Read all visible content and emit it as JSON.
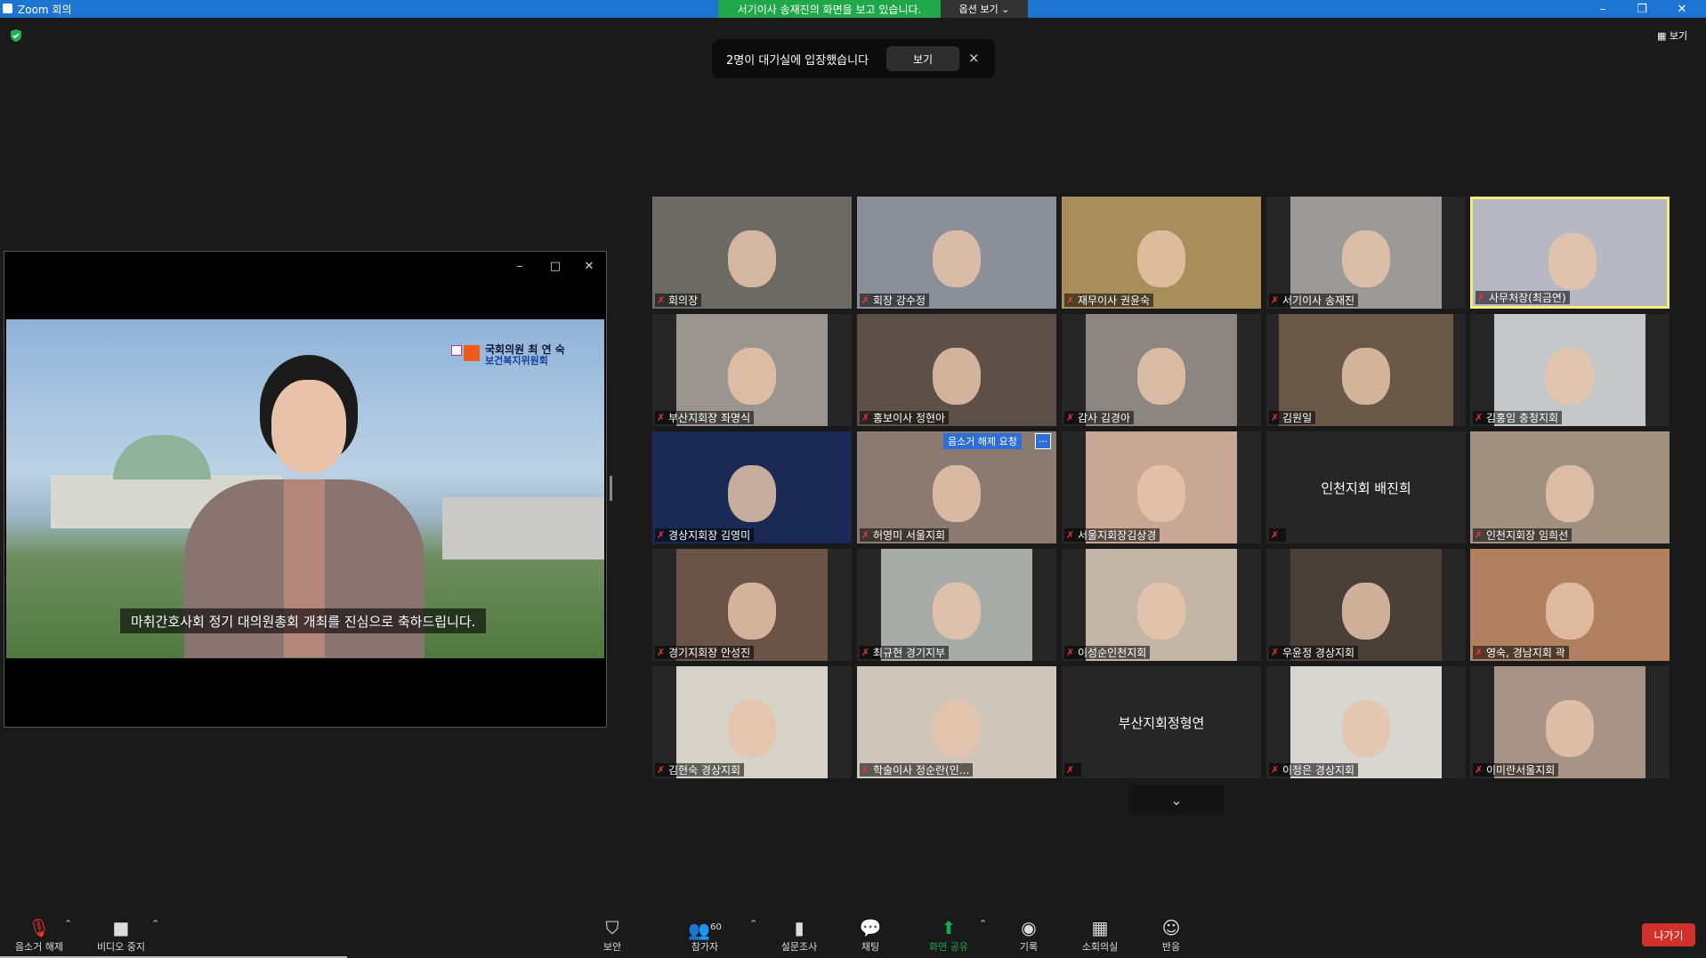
{
  "window": {
    "title": "Zoom 회의",
    "minimize": "–",
    "restore": "❐",
    "close": "✕"
  },
  "share_banner": {
    "text": "서기이사 송재진의 화면을 보고 있습니다.",
    "view_options": "옵션 보기 ⌄"
  },
  "waiting_toast": {
    "message": "2명이 대기실에 입장했습니다",
    "view_button": "보기",
    "close": "×"
  },
  "gallery_view": "▦ 보기",
  "share_window": {
    "minimize": "–",
    "maximize": "□",
    "close": "✕",
    "subtitle": "마취간호사회 정기 대의원총회 개최를 진심으로 축하드립니다.",
    "logo_line1": "국회의원 최 연 숙",
    "logo_line2": "보건복지위원회"
  },
  "participants": [
    {
      "name": "회의장",
      "cam": "#6d6a66"
    },
    {
      "name": "회장 강수정",
      "cam": "#8a8f9a"
    },
    {
      "name": "재무이사 권윤숙",
      "cam": "#a88e5a"
    },
    {
      "name": "서기이사 송재진",
      "cam": "#9b9a96"
    },
    {
      "name": "사무처장(최금연)",
      "cam": "#b8b8c4"
    },
    {
      "name": "부산지회장 좌명식",
      "cam": "#9a958e"
    },
    {
      "name": "홍보이사 정현아",
      "cam": "#5c5048"
    },
    {
      "name": "감사 김경아",
      "cam": "#8c8580"
    },
    {
      "name": "김원일",
      "cam": "#6a5848"
    },
    {
      "name": "김홍임 충청지회",
      "cam": "#c4c8c8"
    },
    {
      "name": "경상지회장 김영미",
      "cam": "#1a2a55"
    },
    {
      "name": "허영미 서울지회",
      "cam": "#8a7a70",
      "request": "음소거 해제 요청",
      "more": "···"
    },
    {
      "name": "서울지회장김상경",
      "cam": "#c9a795"
    },
    {
      "name": "인천지회 배진희",
      "cam": null
    },
    {
      "name": "인천지회장 임희선",
      "cam": "#a09080"
    },
    {
      "name": "경기지회장 안성진",
      "cam": "#6a5448"
    },
    {
      "name": "최규현 경기지부",
      "cam": "#a8aca8"
    },
    {
      "name": "이성순인천지회",
      "cam": "#c3b6a6"
    },
    {
      "name": "우윤정 경상지회",
      "cam": "#4a4038"
    },
    {
      "name": "영숙, 경남지회 곽",
      "cam": "#b08060"
    },
    {
      "name": "김현숙 경상지회",
      "cam": "#d6d2c8"
    },
    {
      "name": "학술이사 정순란(인...",
      "cam": "#cfc6bb"
    },
    {
      "name": "부산지회정형연",
      "cam": null
    },
    {
      "name": "이정은 경상지회",
      "cam": "#d8d6d0"
    },
    {
      "name": "이미란서울지회",
      "cam": "#a89486"
    }
  ],
  "page_down": "⌄",
  "toolbar": {
    "unmute": "음소거 해제",
    "video": "비디오 중지",
    "security": "보안",
    "participants": "참가자",
    "participant_count": "60",
    "polls": "설문조사",
    "chat": "채팅",
    "share": "화면 공유",
    "record": "기록",
    "breakout": "소회의실",
    "reactions": "반응",
    "leave": "나가기"
  },
  "colors": {
    "accent": "#1e74d3",
    "share_green": "#1fa84a",
    "leave_red": "#d1312a",
    "active_speaker": "#f3ec7a"
  }
}
